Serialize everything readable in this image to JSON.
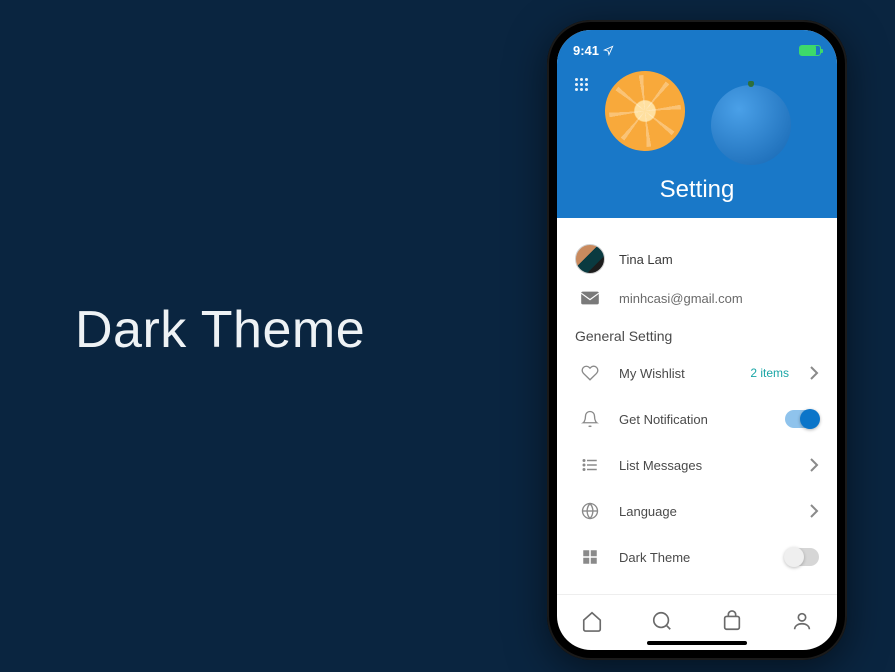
{
  "page": {
    "title": "Dark Theme"
  },
  "status": {
    "time": "9:41"
  },
  "header": {
    "title": "Setting"
  },
  "profile": {
    "name": "Tina Lam",
    "email": "minhcasi@gmail.com"
  },
  "section": {
    "general": "General Setting"
  },
  "rows": {
    "wishlist": {
      "label": "My Wishlist",
      "meta": "2 items"
    },
    "notification": {
      "label": "Get Notification"
    },
    "messages": {
      "label": "List Messages"
    },
    "language": {
      "label": "Language"
    },
    "darktheme": {
      "label": "Dark Theme"
    }
  }
}
